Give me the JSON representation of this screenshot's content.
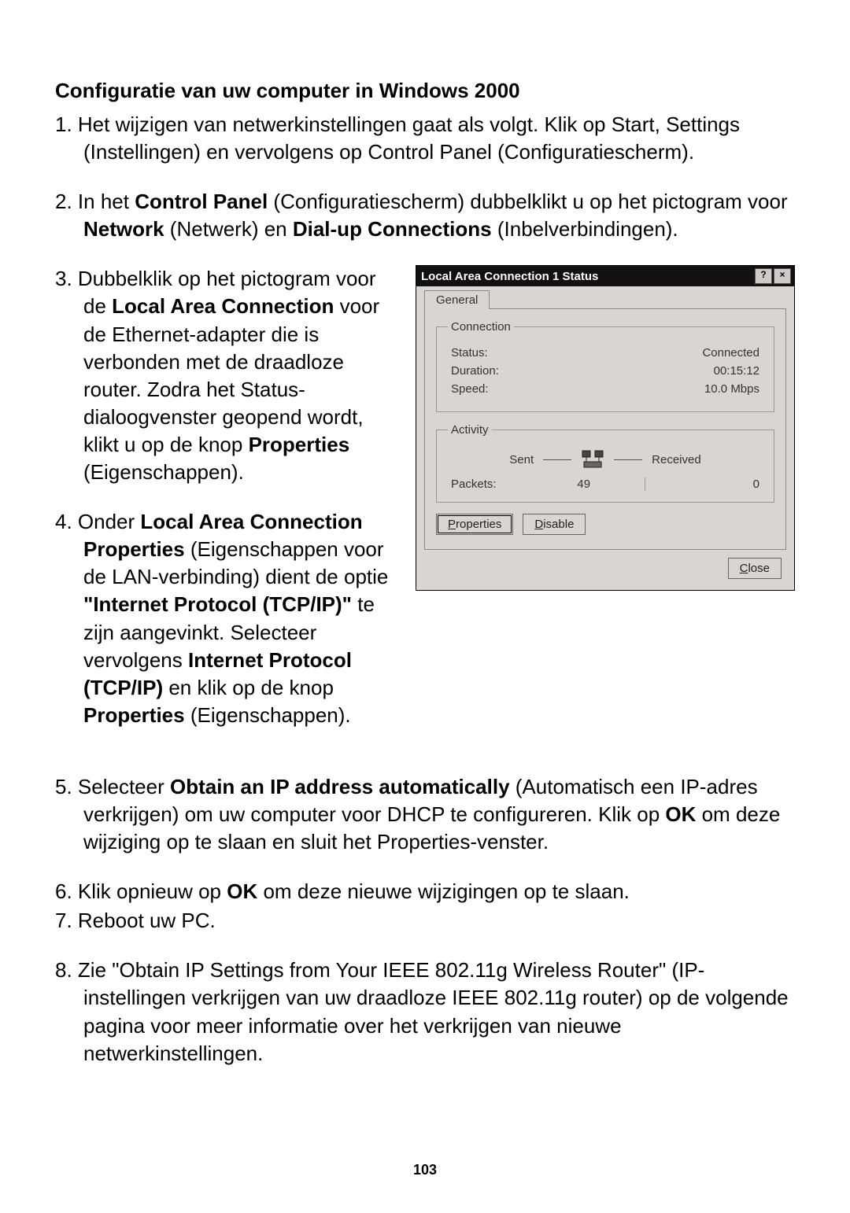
{
  "heading": "Configuratie van uw computer in Windows 2000",
  "step1": "1. Het wijzigen van netwerkinstellingen gaat als volgt. Klik op Start, Settings (Instellingen) en vervolgens op Control Panel (Configuratiescherm).",
  "step2": {
    "pre": "2. In het ",
    "b1": "Control Panel",
    "mid1": " (Configuratiescherm) dubbelklikt u op het pictogram voor ",
    "b2": "Network",
    "mid2": " (Netwerk) en ",
    "b3": "Dial-up Connections",
    "post": " (Inbelverbindingen)."
  },
  "step3": {
    "pre": "3. Dubbelklik op het pictogram voor de ",
    "b1": "Local Area Connection",
    "mid": " voor de Ethernet-adapter die is verbonden met de draadloze router. Zodra het Status-dialoogvenster geopend wordt, klikt u op de knop ",
    "b2": "Properties",
    "post": " (Eigenschappen)."
  },
  "step4": {
    "pre": "4. Onder ",
    "b1": "Local Area Connection Properties",
    "mid1": " (Eigenschappen voor de LAN-verbinding) dient de optie ",
    "b2": "\"Internet Protocol (TCP/IP)\"",
    "mid2": " te zijn aangevinkt. Selecteer vervolgens ",
    "b3": "Internet Protocol (TCP/IP)",
    "mid3": " en klik op de knop ",
    "b4": "Properties",
    "post": " (Eigenschappen)."
  },
  "step5": {
    "pre": "5. Selecteer ",
    "b1": "Obtain an IP address automatically",
    "mid1": " (Automatisch een IP-adres verkrijgen) om uw computer voor DHCP te configureren. Klik op ",
    "b2": "OK",
    "post": " om deze wijziging op te slaan en sluit het Properties-venster."
  },
  "step6": {
    "pre": "6. Klik opnieuw op ",
    "b1": "OK",
    "post": " om deze nieuwe wijzigingen op te slaan."
  },
  "step7": "7. Reboot uw PC.",
  "step8": "8. Zie \"Obtain IP Settings from Your IEEE 802.11g Wireless Router\" (IP-instellingen verkrijgen van uw draadloze IEEE 802.11g router) op de volgende pagina voor meer informatie over het verkrijgen van nieuwe netwerkinstellingen.",
  "page_number": "103",
  "dialog": {
    "title": "Local Area Connection 1 Status",
    "help_btn": "?",
    "close_btn": "×",
    "tab_general": "General",
    "group_connection": "Connection",
    "status_label": "Status:",
    "status_value": "Connected",
    "duration_label": "Duration:",
    "duration_value": "00:15:12",
    "speed_label": "Speed:",
    "speed_value": "10.0 Mbps",
    "group_activity": "Activity",
    "sent_label": "Sent",
    "received_label": "Received",
    "packets_label": "Packets:",
    "packets_sent": "49",
    "packets_received": "0",
    "properties_btn": "Properties",
    "disable_btn": "Disable",
    "close_button": "Close"
  }
}
